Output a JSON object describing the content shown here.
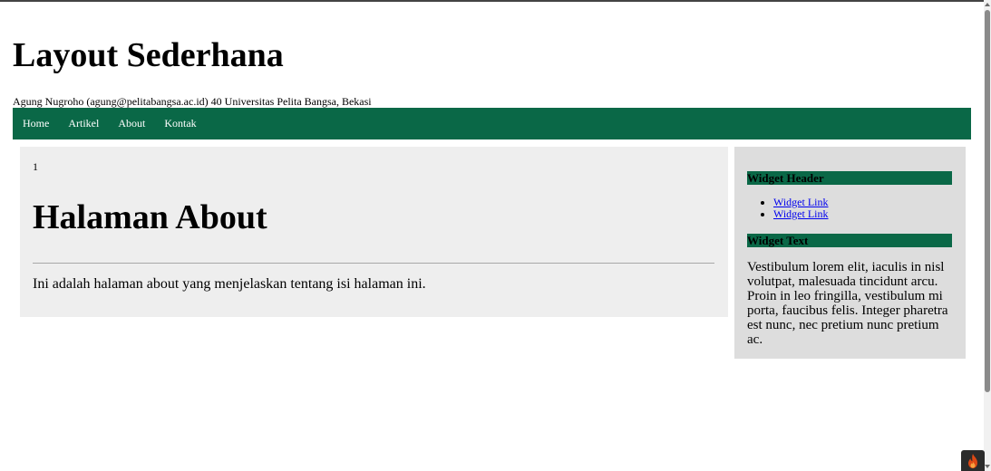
{
  "header": {
    "site_title": "Layout Sederhana",
    "contact_line": "Agung Nugroho (agung@pelitabangsa.ac.id) 40 Universitas Pelita Bangsa, Bekasi"
  },
  "nav": {
    "items": [
      {
        "label": "Home"
      },
      {
        "label": "Artikel"
      },
      {
        "label": "About"
      },
      {
        "label": "Kontak"
      }
    ],
    "background_color": "#0a6847"
  },
  "main": {
    "page_number": "1",
    "heading": "Halaman About",
    "body_text": "Ini adalah halaman about yang menjelaskan tentang isi halaman ini."
  },
  "sidebar": {
    "widget_header_title": "Widget Header",
    "widget_links": [
      {
        "label": "Widget Link"
      },
      {
        "label": "Widget Link"
      }
    ],
    "widget_text_title": "Widget Text",
    "widget_text_body": "Vestibulum lorem elit, iaculis in nisl volutpat, malesuada tincidunt arcu. Proin in leo fringilla, vestibulum mi porta, faucibus felis. Integer pharetra est nunc, nec pretium nunc pretium ac."
  },
  "icons": {
    "debug_toolbar": "codeigniter-flame-icon"
  }
}
